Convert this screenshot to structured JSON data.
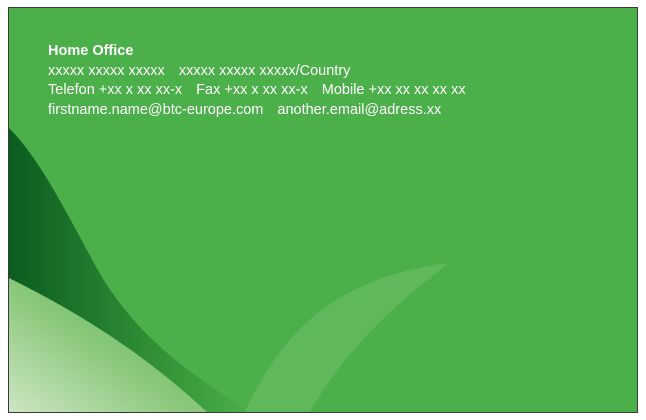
{
  "card": {
    "title": "Home Office",
    "address_left": "xxxxx xxxxx xxxxx",
    "address_right": "xxxxx xxxxx xxxxx/Country",
    "phone": "Telefon +xx x xx xx-x",
    "fax": "Fax +xx x xx xx-x",
    "mobile": "Mobile +xx xx xx xx xx",
    "email_primary": "firstname.name@btc-europe.com",
    "email_secondary": "another.email@adress.xx"
  },
  "colors": {
    "card_green": "#4cb04a",
    "dark_green": "#0b5c1f",
    "pale_green": "#cfe6c4",
    "text": "#ffffff"
  }
}
